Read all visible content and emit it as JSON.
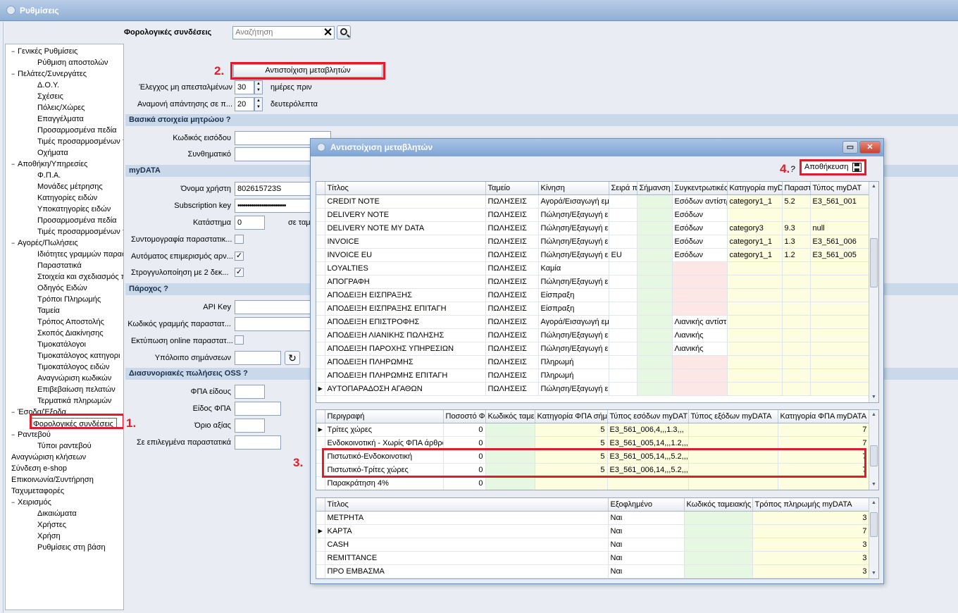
{
  "window": {
    "title": "Ρυθμίσεις"
  },
  "search": {
    "label": "Φορολογικές συνδέσεις",
    "placeholder": "Αναζήτηση",
    "clear": "✕"
  },
  "tree": [
    {
      "label": "Γενικές Ρυθμίσεις",
      "level": 0,
      "toggle": "−"
    },
    {
      "label": "Ρύθμιση αποστολών",
      "level": 1
    },
    {
      "label": "Πελάτες/Συνεργάτες",
      "level": 0,
      "toggle": "−"
    },
    {
      "label": "Δ.Ο.Υ.",
      "level": 1
    },
    {
      "label": "Σχέσεις",
      "level": 1
    },
    {
      "label": "Πόλεις/Χώρες",
      "level": 1
    },
    {
      "label": "Επαγγέλματα",
      "level": 1
    },
    {
      "label": "Προσαρμοσμένα πεδία",
      "level": 1
    },
    {
      "label": "Τιμές προσαρμοσμένων π",
      "level": 1
    },
    {
      "label": "Οχήματα",
      "level": 1
    },
    {
      "label": "Αποθήκη/Υπηρεσίες",
      "level": 0,
      "toggle": "−"
    },
    {
      "label": "Φ.Π.Α.",
      "level": 1
    },
    {
      "label": "Μονάδες μέτρησης",
      "level": 1
    },
    {
      "label": "Κατηγορίες ειδών",
      "level": 1
    },
    {
      "label": "Υποκατηγορίες ειδών",
      "level": 1
    },
    {
      "label": "Προσαρμοσμένα πεδία",
      "level": 1
    },
    {
      "label": "Τιμές προσαρμοσμένων π",
      "level": 1
    },
    {
      "label": "Αγορές/Πωλήσεις",
      "level": 0,
      "toggle": "−"
    },
    {
      "label": "Ιδιότητες γραμμών παρασ",
      "level": 1
    },
    {
      "label": "Παραστατικά",
      "level": 1
    },
    {
      "label": "Στοιχεία και σχεδιασμός π",
      "level": 1
    },
    {
      "label": "Οδηγός Ειδών",
      "level": 1
    },
    {
      "label": "Τρόποι Πληρωμής",
      "level": 1
    },
    {
      "label": "Ταμεία",
      "level": 1
    },
    {
      "label": "Τρόπος Αποστολής",
      "level": 1
    },
    {
      "label": "Σκοπός Διακίνησης",
      "level": 1
    },
    {
      "label": "Τιμοκατάλογοι",
      "level": 1
    },
    {
      "label": "Τιμοκατάλογος κατηγορι",
      "level": 1
    },
    {
      "label": "Τιμοκατάλογος ειδών",
      "level": 1
    },
    {
      "label": "Αναγνώριση κωδικών",
      "level": 1
    },
    {
      "label": "Επιβεβαίωση πελατών",
      "level": 1
    },
    {
      "label": "Τερματικά πληρωμών",
      "level": 1
    },
    {
      "label": "Έσοδα/Έξοδα",
      "level": 0,
      "toggle": "−"
    },
    {
      "label": "Φορολογικές συνδέσεις",
      "level": 1,
      "selected": true
    },
    {
      "label": "Ραντεβού",
      "level": 0,
      "toggle": "−"
    },
    {
      "label": "Τύποι ραντεβού",
      "level": 1
    },
    {
      "label": "Αναγνώριση κλήσεων",
      "level": 0
    },
    {
      "label": "Σύνδεση e-shop",
      "level": 0
    },
    {
      "label": "Επικοινωνία/Συντήρηση",
      "level": 0
    },
    {
      "label": "Ταχυμεταφορές",
      "level": 0
    },
    {
      "label": "Χειρισμός",
      "level": 0,
      "toggle": "−"
    },
    {
      "label": "Δικαιώματα",
      "level": 1
    },
    {
      "label": "Χρήστες",
      "level": 1
    },
    {
      "label": "Χρήση",
      "level": 1
    },
    {
      "label": "Ρυθμίσεις στη βάση",
      "level": 1
    }
  ],
  "form": {
    "map_button": "Αντιστοίχιση μεταβλητών",
    "check_label": "Έλεγχος μη απεσταλμένων",
    "check_value": "30",
    "check_unit": "ημέρες πριν",
    "wait_label": "Αναμονή απάντησης σε π...",
    "wait_value": "20",
    "wait_unit": "δευτερόλεπτα",
    "sec_registry": "Βασικά στοιχεία μητρώου ?",
    "login_code": "Κωδικός εισόδου",
    "password": "Συνθηματικό",
    "sec_mydata": "myDATA",
    "username_label": "Όνομα χρήστη",
    "username_value": "802615723S",
    "subkey_label": "Subscription key",
    "subkey_value": "••••••••••••••••••••••••",
    "store_label": "Κατάστημα",
    "store_value": "0",
    "store_suffix": "σε ταμ",
    "abbr_label": "Συντομογραφία παραστατικ...",
    "auto_label": "Αυτόματος επιμερισμός αρν...",
    "round_label": "Στρογγυλοποίηση με 2 δεκ...",
    "check_mark": "✓",
    "sec_provider": "Πάροχος ?",
    "apikey_label": "API Key",
    "linecode_label": "Κωδικός γραμμής παραστατ...",
    "print_label": "Εκτύπωση online παραστατ...",
    "balance_label": "Υπόλοιπο σημάνσεων",
    "refresh": "↻",
    "sec_oss": "Διασυνοριακές πωλήσεις OSS ?",
    "vat_item": "ΦΠΑ είδους",
    "vat_type": "Είδος ΦΠΑ",
    "limit": "Όριο αξίας",
    "selected_docs": "Σε επιλεγμένα παραστατικά"
  },
  "markers": {
    "m1": "1.",
    "m2": "2.",
    "m3": "3.",
    "m4": "4."
  },
  "dialog": {
    "title": "Αντιστοίχιση μεταβλητών",
    "minimize": "▭",
    "close": "✕",
    "help": "?",
    "save": "Αποθήκευση",
    "grid1": {
      "headers": [
        "Τίτλος",
        "Ταμείο",
        "Κίνηση",
        "Σειρά π",
        "Σήμανση",
        "Συγκεντρωτικές",
        "Κατηγορία myDa",
        "Παραστ",
        "Τύπος myDAT"
      ],
      "rows": [
        [
          "",
          "CREDIT NOTE",
          "ΠΩΛΗΣΕΙΣ",
          "Αγορά/Εισαγωγή εμ",
          "",
          "",
          "Εσόδων αντίστρ",
          "category1_1",
          "5.2",
          "E3_561_001"
        ],
        [
          "",
          "DELIVERY NOTE",
          "ΠΩΛΗΣΕΙΣ",
          "Πώληση/Εξαγωγή ε",
          "",
          "",
          "Εσόδων",
          "",
          "",
          ""
        ],
        [
          "",
          "DELIVERY NOTE MY DATA",
          "ΠΩΛΗΣΕΙΣ",
          "Πώληση/Εξαγωγή ε",
          "",
          "",
          "Εσόδων",
          "category3",
          "9.3",
          "null"
        ],
        [
          "",
          "INVOICE",
          "ΠΩΛΗΣΕΙΣ",
          "Πώληση/Εξαγωγή ε",
          "",
          "",
          "Εσόδων",
          "category1_1",
          "1.3",
          "E3_561_006"
        ],
        [
          "",
          "INVOICE EU",
          "ΠΩΛΗΣΕΙΣ",
          "Πώληση/Εξαγωγή ε",
          "EU",
          "",
          "Εσόδων",
          "category1_1",
          "1.2",
          "E3_561_005"
        ],
        [
          "",
          "LOYALTIES",
          "ΠΩΛΗΣΕΙΣ",
          "Καμία",
          "",
          "",
          "",
          "",
          "",
          ""
        ],
        [
          "",
          "ΑΠΟΓΡΑΦΗ",
          "ΠΩΛΗΣΕΙΣ",
          "Πώληση/Εξαγωγή ε",
          "",
          "",
          "",
          "",
          "",
          ""
        ],
        [
          "",
          "ΑΠΟΔΕΙΞΗ ΕΙΣΠΡΑΞΗΣ",
          "ΠΩΛΗΣΕΙΣ",
          "Είσπραξη",
          "",
          "",
          "",
          "",
          "",
          ""
        ],
        [
          "",
          "ΑΠΟΔΕΙΞΗ ΕΙΣΠΡΑΞΗΣ ΕΠΙΤΑΓΗ",
          "ΠΩΛΗΣΕΙΣ",
          "Είσπραξη",
          "",
          "",
          "",
          "",
          "",
          ""
        ],
        [
          "",
          "ΑΠΟΔΕΙΞΗ ΕΠΙΣΤΡΟΦΗΣ",
          "ΠΩΛΗΣΕΙΣ",
          "Αγορά/Εισαγωγή εμ",
          "",
          "",
          "Λιανικής αντίστρ",
          "",
          "",
          ""
        ],
        [
          "",
          "ΑΠΟΔΕΙΞΗ ΛΙΑΝΙΚΗΣ ΠΩΛΗΣΗΣ",
          "ΠΩΛΗΣΕΙΣ",
          "Πώληση/Εξαγωγή ε",
          "",
          "",
          "Λιανικής",
          "",
          "",
          ""
        ],
        [
          "",
          "ΑΠΟΔΕΙΞΗ ΠΑΡΟΧΗΣ ΥΠΗΡΕΣΙΩΝ",
          "ΠΩΛΗΣΕΙΣ",
          "Πώληση/Εξαγωγή ε",
          "",
          "",
          "Λιανικής",
          "",
          "",
          ""
        ],
        [
          "",
          "ΑΠΟΔΕΙΞΗ ΠΛΗΡΩΜΗΣ",
          "ΠΩΛΗΣΕΙΣ",
          "Πληρωμή",
          "",
          "",
          "",
          "",
          "",
          ""
        ],
        [
          "",
          "ΑΠΟΔΕΙΞΗ ΠΛΗΡΩΜΗΣ ΕΠΙΤΑΓΗ",
          "ΠΩΛΗΣΕΙΣ",
          "Πληρωμή",
          "",
          "",
          "",
          "",
          "",
          ""
        ],
        [
          "▶",
          "ΑΥΤΟΠΑΡΑΔΟΣΗ ΑΓΑΘΩΝ",
          "ΠΩΛΗΣΕΙΣ",
          "Πώληση/Εξαγωγή ε",
          "",
          "",
          "",
          "",
          "",
          ""
        ]
      ]
    },
    "grid2": {
      "headers": [
        "Περιγραφή",
        "Ποσοστό Φ",
        "Κωδικός ταμει",
        "Κατηγορία ΦΠΑ σήμ",
        "Τύπος εσόδων myDAT",
        "Τύπος εξόδων myDATA",
        "Κατηγορία ΦΠΑ myDATA"
      ],
      "rows": [
        [
          "▶",
          "Τρίτες χώρες",
          "0",
          "",
          "5",
          "E3_561_006,4,,,1.3,,,",
          "",
          "7"
        ],
        [
          "",
          "Ενδοκοινοτική - Χωρίς ΦΠΑ άρθρο",
          "0",
          "",
          "5",
          "E3_561_005,14,,,1.2,,,",
          "",
          "7"
        ],
        [
          "",
          "Πιστωτικό-Ενδοκοινοτική",
          "0",
          "",
          "5",
          "E3_561_005,14,,,5.2,,,",
          "",
          "7"
        ],
        [
          "",
          "Πιστωτικό-Τρίτες χώρες",
          "0",
          "",
          "5",
          "E3_561_006,14,,,5.2,,,",
          "",
          "7"
        ],
        [
          "",
          "Παρακράτηση 4%",
          "0",
          "",
          "",
          "",
          "",
          ""
        ]
      ]
    },
    "grid3": {
      "headers": [
        "Τίτλος",
        "Εξοφλημένο",
        "Κωδικός ταμειακής",
        "Τρόπος πληρωμής myDATA"
      ],
      "rows": [
        [
          "",
          "ΜΕΤΡΗΤΑ",
          "Ναι",
          "",
          "3"
        ],
        [
          "▶",
          "ΚΑΡΤΑ",
          "Ναι",
          "",
          "7"
        ],
        [
          "",
          "CASH",
          "Ναι",
          "",
          "3"
        ],
        [
          "",
          "REMITTANCE",
          "Ναι",
          "",
          "3"
        ],
        [
          "",
          "ΠΡΟ ΕΜΒΑΣΜΑ",
          "Ναι",
          "",
          "3"
        ]
      ]
    }
  },
  "colors": {
    "title_bar": "#8fb0d6",
    "highlight_red": "#e21b2a",
    "green_cell": "#e6f7e2",
    "yellow_cell": "#fdfde0",
    "red_cell": "#fde6e6"
  },
  "icons": {
    "app": "settings-circle-icon",
    "search": "magnifier-icon",
    "save": "floppy-disk-icon"
  }
}
